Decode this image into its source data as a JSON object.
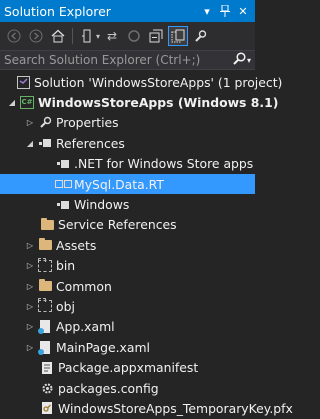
{
  "window": {
    "title": "Solution Explorer",
    "controls": [
      "pin-dropdown-icon",
      "pin-icon",
      "close-icon"
    ]
  },
  "toolbar": {
    "buttons": [
      "back-icon",
      "forward-icon",
      "home-icon",
      "pending-changes-filter-icon",
      "sync-icon",
      "refresh-icon",
      "collapse-all-icon",
      "show-all-files-icon",
      "properties-icon"
    ]
  },
  "search": {
    "placeholder": "Search Solution Explorer (Ctrl+;)"
  },
  "tree": {
    "items": [
      {
        "label": "Solution 'WindowsStoreApps' (1 project)",
        "icon": "solution-icon",
        "expanded": null
      },
      {
        "label": "WindowsStoreApps (Windows 8.1)",
        "icon": "csharp-project-icon",
        "expanded": true
      },
      {
        "label": "Properties",
        "icon": "properties-wrench-icon",
        "expanded": false
      },
      {
        "label": "References",
        "icon": "references-icon",
        "expanded": true
      },
      {
        "label": ".NET for Windows Store apps",
        "icon": "reference-icon",
        "expanded": null
      },
      {
        "label": "MySql.Data.RT",
        "icon": "reference-icon",
        "expanded": null,
        "selected": true
      },
      {
        "label": "Windows",
        "icon": "reference-icon",
        "expanded": null
      },
      {
        "label": "Service References",
        "icon": "folder-icon",
        "expanded": null
      },
      {
        "label": "Assets",
        "icon": "folder-icon",
        "expanded": false
      },
      {
        "label": "bin",
        "icon": "folder-dashed-icon",
        "expanded": false
      },
      {
        "label": "Common",
        "icon": "folder-icon",
        "expanded": false
      },
      {
        "label": "obj",
        "icon": "folder-dashed-icon",
        "expanded": false
      },
      {
        "label": "App.xaml",
        "icon": "xaml-file-icon",
        "expanded": false
      },
      {
        "label": "MainPage.xaml",
        "icon": "xaml-file-icon",
        "expanded": false
      },
      {
        "label": "Package.appxmanifest",
        "icon": "manifest-file-icon",
        "expanded": null
      },
      {
        "label": "packages.config",
        "icon": "config-file-icon",
        "expanded": null
      },
      {
        "label": "WindowsStoreApps_TemporaryKey.pfx",
        "icon": "key-file-icon",
        "expanded": null
      }
    ]
  },
  "colors": {
    "accent": "#007acc",
    "selection": "#3399ff",
    "background": "#252526"
  }
}
